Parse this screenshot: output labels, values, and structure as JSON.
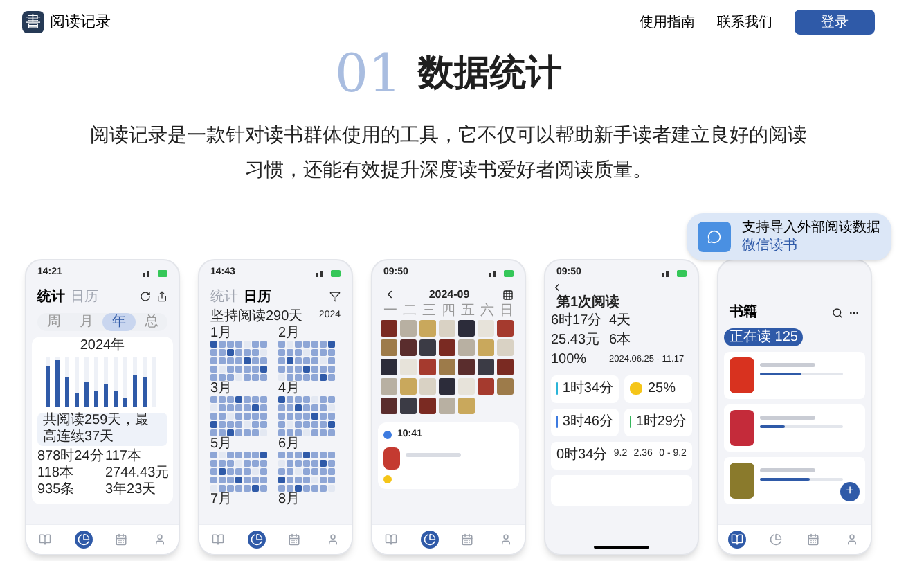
{
  "header": {
    "logo_glyph": "書",
    "app_name": "阅读记录",
    "nav_links": [
      "使用指南",
      "联系我们"
    ],
    "login_button": "登录"
  },
  "section": {
    "number": "01",
    "title": "数据统计",
    "description": "阅读记录是一款针对读书群体使用的工具，它不仅可以帮助新手读者建立良好的阅读习惯，还能有效提升深度读书爱好者阅读质量。"
  },
  "callout": {
    "text": "支持导入外部阅读数据",
    "link": "微信读书"
  },
  "phones": [
    {
      "kind": "stats",
      "time": "14:21",
      "tabs": [
        {
          "label": "统计",
          "selected": true
        },
        {
          "label": "日历",
          "selected": false
        }
      ],
      "segments": [
        {
          "label": "周",
          "selected": false
        },
        {
          "label": "月",
          "selected": false
        },
        {
          "label": "年",
          "selected": true
        },
        {
          "label": "总",
          "selected": false
        }
      ],
      "year": "2024年",
      "summary": "共阅读259天，最高连续37天",
      "stats": [
        "878时24分",
        "117本",
        "118本",
        "2744.43元",
        "935条",
        "3年23天"
      ],
      "nav": [
        {
          "selected": false
        },
        {
          "selected": true
        },
        {
          "selected": false
        },
        {
          "selected": false
        }
      ]
    },
    {
      "kind": "calendar",
      "time": "14:43",
      "tabs": [
        {
          "label": "统计",
          "selected": false
        },
        {
          "label": "日历",
          "selected": true
        }
      ],
      "streak": "坚持阅读290天",
      "year": "2024",
      "months": [
        "1月",
        "2月",
        "3月",
        "4月",
        "5月",
        "6月",
        "7月",
        "8月"
      ],
      "nav": [
        {
          "selected": false
        },
        {
          "selected": true
        },
        {
          "selected": false
        },
        {
          "selected": false
        }
      ]
    },
    {
      "kind": "month",
      "time": "09:50",
      "month": "2024-09",
      "weekdays": [
        "一",
        "二",
        "三",
        "四",
        "五",
        "六",
        "日"
      ],
      "entry_time": "10:41",
      "nav": [
        {
          "selected": false
        },
        {
          "selected": true
        },
        {
          "selected": false
        },
        {
          "selected": false
        }
      ]
    },
    {
      "kind": "session",
      "time": "09:50",
      "title": "第1次阅读",
      "stats": [
        "6时17分",
        "4天",
        "25.43元",
        "6本",
        "100%",
        "2024.06.25 - 11.17"
      ],
      "cards": [
        {
          "value": "1时34分",
          "color": "#2bb5d8"
        },
        {
          "value": "25%",
          "color": "#f5c518"
        },
        {
          "value": "3时46分",
          "color": "#3d7be0"
        },
        {
          "value": "1时29分",
          "color": "#34b55a"
        }
      ],
      "session": [
        "0时34分",
        "9.2",
        "2.36",
        "0 - 9.2"
      ]
    },
    {
      "kind": "shelf",
      "tabs": [
        {
          "label": "书籍",
          "selected": true
        }
      ],
      "chips": [
        {
          "label": "正在读 125",
          "selected": true
        }
      ],
      "books": [
        {
          "color": "#d8321f",
          "level": 0.5
        },
        {
          "color": "#c42b3a",
          "level": 0.3
        },
        {
          "color": "#8a7a2c",
          "level": 0.6
        }
      ],
      "fab": "+",
      "nav": [
        {
          "selected": true
        },
        {
          "selected": false
        },
        {
          "selected": false
        },
        {
          "selected": false
        }
      ]
    }
  ]
}
